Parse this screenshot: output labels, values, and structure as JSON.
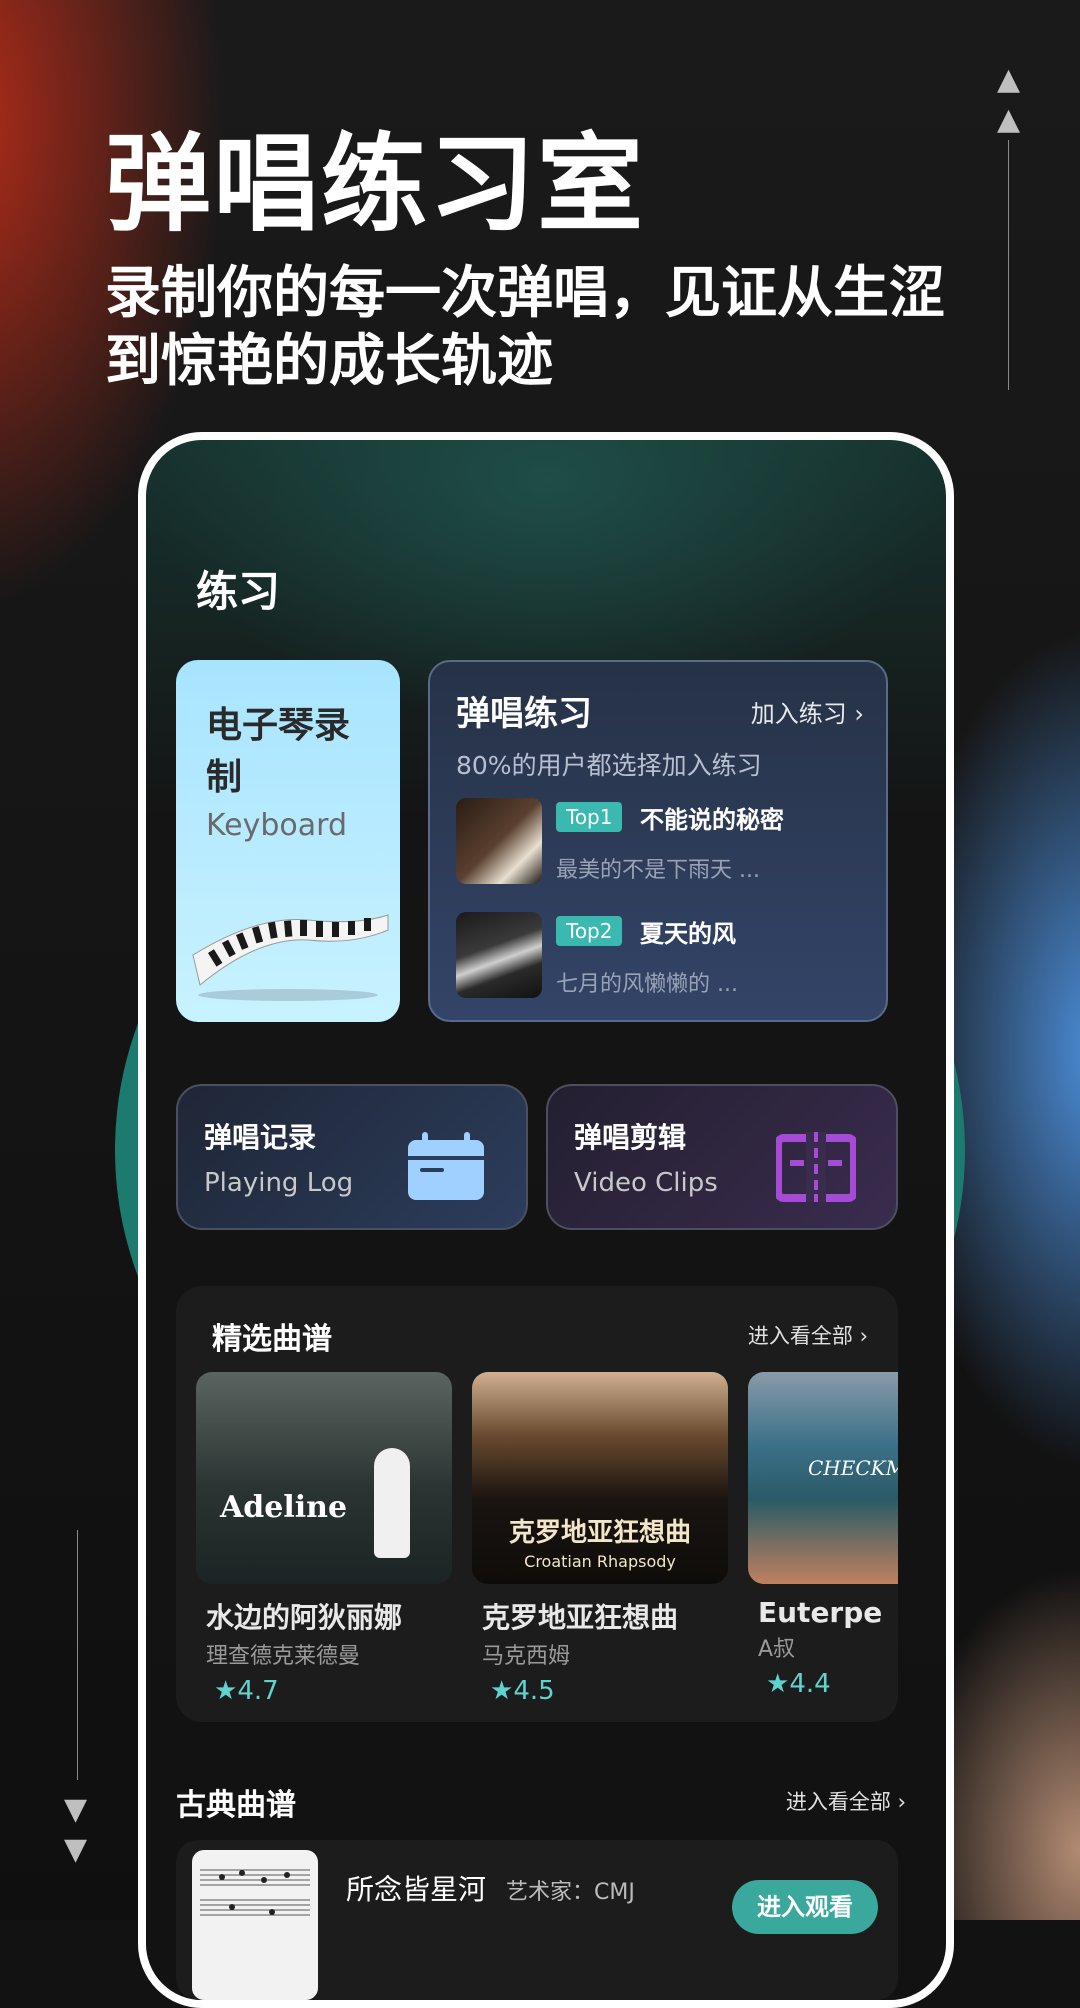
{
  "header": {
    "title": "弹唱练习室",
    "subtitle": "录制你的每一次弹唱，见证从生涩到惊艳的成长轨迹"
  },
  "colors": {
    "accent_teal": "#3bb8b0",
    "teal_disc": "#1d7a6e",
    "rating": "#5fd3d0",
    "clips_purple": "#a54bd6",
    "log_blue": "#9fd0ff"
  },
  "phone": {
    "section_title": "练习",
    "keyboard_card": {
      "title": "电子琴录制",
      "subtitle": "Keyboard",
      "icon": "piano-keys-icon"
    },
    "sing_card": {
      "title": "弹唱练习",
      "join_label": "加入练习",
      "subtitle": "80%的用户都选择加入练习",
      "songs": [
        {
          "badge": "Top1",
          "name": "不能说的秘密",
          "desc": "最美的不是下雨天 ..."
        },
        {
          "badge": "Top2",
          "name": "夏天的风",
          "desc": "七月的风懒懒的 ..."
        }
      ]
    },
    "log_card": {
      "title": "弹唱记录",
      "subtitle": "Playing Log",
      "icon": "calendar-icon"
    },
    "clips_card": {
      "title": "弹唱剪辑",
      "subtitle": "Video Clips",
      "icon": "video-cut-icon"
    },
    "featured": {
      "title": "精选曲谱",
      "more_label": "进入看全部",
      "scores": [
        {
          "name": "水边的阿狄丽娜",
          "artist": "理查德克莱德曼",
          "rating": "4.7",
          "cover_text": "Adeline"
        },
        {
          "name": "克罗地亚狂想曲",
          "artist": "马克西姆",
          "rating": "4.5",
          "cover_text": "克罗地亚狂想曲",
          "cover_subtext": "Croatian Rhapsody"
        },
        {
          "name": "Euterpe",
          "artist": "A叔",
          "rating": "4.4",
          "cover_text": "CHECKM"
        }
      ]
    },
    "classic": {
      "title": "古典曲谱",
      "more_label": "进入看全部",
      "items": [
        {
          "name": "所念皆星河",
          "artist": "艺术家：CMJ",
          "button": "进入观看"
        }
      ]
    }
  }
}
